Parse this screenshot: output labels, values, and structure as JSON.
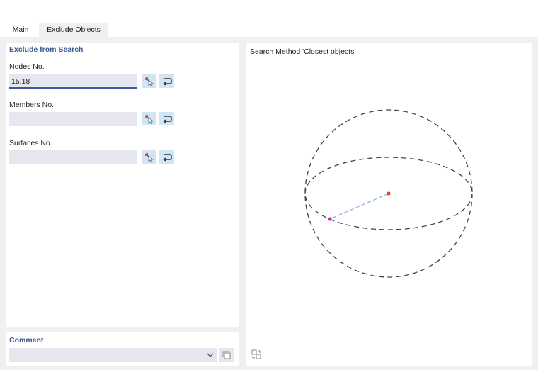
{
  "tabs": [
    {
      "label": "Main"
    },
    {
      "label": "Exclude Objects"
    }
  ],
  "exclude": {
    "title": "Exclude from Search",
    "nodes": {
      "label": "Nodes No.",
      "value": "15,18"
    },
    "members": {
      "label": "Members No.",
      "value": ""
    },
    "surfaces": {
      "label": "Surfaces No.",
      "value": ""
    }
  },
  "view": {
    "title": "Search Method 'Closest objects'"
  },
  "comment": {
    "title": "Comment",
    "value": ""
  },
  "icons": {
    "select": "select-objects-icon",
    "clear": "clear-selection-icon",
    "comment_library": "copy-icon",
    "view_options": "view-settings-icon",
    "dropdown": "chevron-down-icon"
  },
  "colors": {
    "accent": "#3b5b8c",
    "button_bg": "#d2e5f4",
    "center_node": "#e0471b",
    "closest_node": "#c030c0",
    "search_line": "#8fb4e0"
  }
}
